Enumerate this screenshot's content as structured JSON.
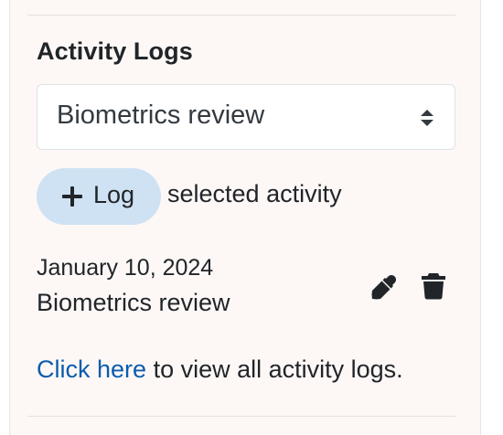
{
  "activity_logs": {
    "title": "Activity Logs",
    "select": {
      "selected_value": "Biometrics review"
    },
    "log_button": {
      "label": "Log",
      "suffix_text": "selected activity"
    },
    "entries": [
      {
        "date": "January 10, 2024",
        "name": "Biometrics review"
      }
    ],
    "footer": {
      "link_text": "Click here",
      "suffix_text": "to view all activity logs."
    }
  },
  "icons": {
    "select": "sort-arrows-icon",
    "add": "plus-icon",
    "edit": "eyedropper-edit-icon",
    "delete": "trash-icon"
  },
  "colors": {
    "panel_background": "#fdf8f6",
    "button_background": "#cfe2f3",
    "link": "#0b5cad"
  }
}
